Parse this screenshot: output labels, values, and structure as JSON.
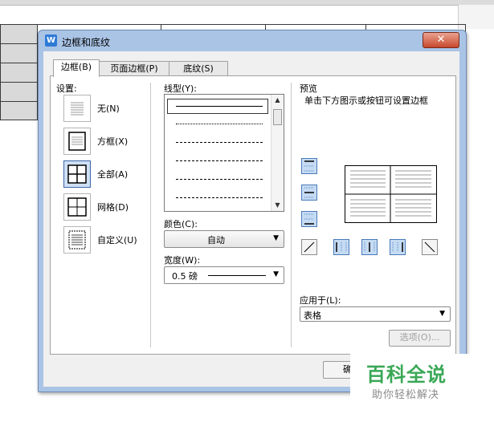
{
  "dialog": {
    "title": "边框和底纹",
    "app_icon": "W",
    "close_icon": "✕"
  },
  "tabs": [
    {
      "label": "边框(B)",
      "active": true
    },
    {
      "label": "页面边框(P)",
      "active": false
    },
    {
      "label": "底纹(S)",
      "active": false
    }
  ],
  "settings": {
    "label": "设置:",
    "options": [
      {
        "label": "无(N)",
        "icon": "border-none-icon"
      },
      {
        "label": "方框(X)",
        "icon": "border-box-icon"
      },
      {
        "label": "全部(A)",
        "icon": "border-all-icon",
        "selected": true
      },
      {
        "label": "网格(D)",
        "icon": "border-grid-icon"
      },
      {
        "label": "自定义(U)",
        "icon": "border-custom-icon"
      }
    ]
  },
  "line_style": {
    "label": "线型(Y):",
    "styles": [
      "solid",
      "dotted",
      "dashed-small",
      "dashed",
      "dash-dot",
      "dash-dot-dot"
    ]
  },
  "color": {
    "label": "颜色(C):",
    "value": "自动"
  },
  "width": {
    "label": "宽度(W):",
    "value": "0.5 磅"
  },
  "preview": {
    "label": "预览",
    "hint": "单击下方图示或按钮可设置边框"
  },
  "apply_to": {
    "label": "应用于(L):",
    "value": "表格"
  },
  "buttons": {
    "options": "选项(O)...",
    "ok": "确"
  },
  "watermark": {
    "title": "百科全说",
    "subtitle": "助你轻松解决"
  },
  "colors": {
    "dialog_frame": "#aac4e6",
    "close_button": "#c8482d",
    "selected_item": "#cfe0f5",
    "watermark_green": "#3aa856"
  }
}
